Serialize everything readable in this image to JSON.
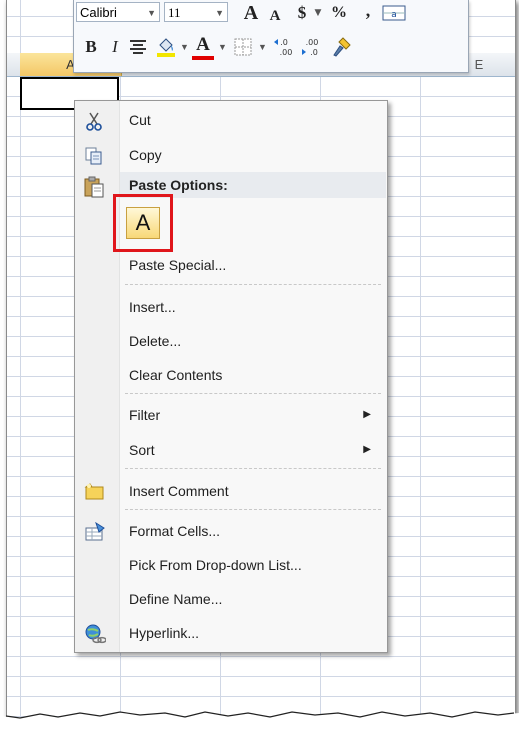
{
  "mini_toolbar": {
    "font_name": "Calibri",
    "font_size": "11",
    "grow_font": "A",
    "shrink_font": "A",
    "currency": "$",
    "percent": "%",
    "comma": ",",
    "bold": "B",
    "italic": "I",
    "font_color_letter": "A"
  },
  "sheet": {
    "column_a": "A",
    "column_e": "E"
  },
  "context_menu": {
    "cut": "Cut",
    "copy": "Copy",
    "paste_options": "Paste Options:",
    "paste_option_letter": "A",
    "paste_special": "Paste Special...",
    "insert": "Insert...",
    "delete": "Delete...",
    "clear_contents": "Clear Contents",
    "filter": "Filter",
    "sort": "Sort",
    "insert_comment": "Insert Comment",
    "format_cells": "Format Cells...",
    "pick_from_list": "Pick From Drop-down List...",
    "define_name": "Define Name...",
    "hyperlink": "Hyperlink..."
  },
  "colors": {
    "highlight_box": "#e0161b",
    "font_color_bar": "#e00000",
    "column_selected": "#f4c766"
  }
}
